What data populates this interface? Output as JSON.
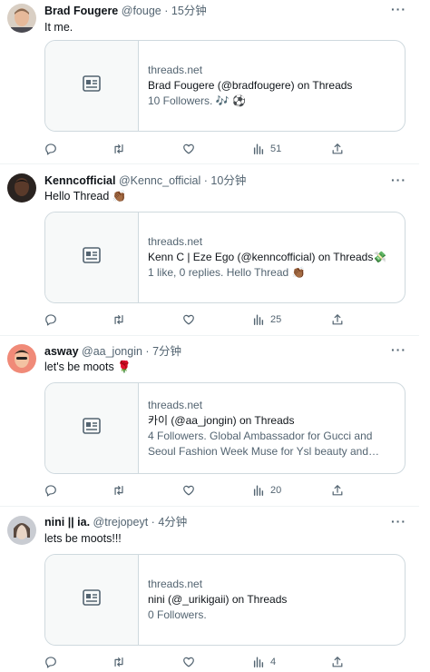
{
  "icons": {
    "reply": "reply-icon",
    "retweet": "retweet-icon",
    "like": "heart-icon",
    "views": "views-icon",
    "share": "share-icon",
    "more": "more-icon",
    "card": "article-icon"
  },
  "tweets": [
    {
      "name": "Brad Fougere",
      "handle": "@fouge",
      "dot": "·",
      "time": "15分钟",
      "text": "It me.",
      "more": "···",
      "card": {
        "domain": "threads.net",
        "title": "Brad Fougere (@bradfougere) on Threads",
        "desc": "10 Followers. 🎶 ⚽"
      },
      "views": "51"
    },
    {
      "name": "Kenncofficial",
      "handle": "@Kennc_official",
      "dot": "·",
      "time": "10分钟",
      "text": "Hello Thread 👏🏾",
      "more": "···",
      "card": {
        "domain": "threads.net",
        "title": "Kenn C | Eze Ego (@kenncofficial) on Threads💸",
        "desc": "1 like, 0 replies. Hello Thread 👏🏾"
      },
      "views": "25"
    },
    {
      "name": "asway",
      "handle": "@aa_jongin",
      "dot": "·",
      "time": "7分钟",
      "text": "let's be moots 🌹",
      "more": "···",
      "card": {
        "domain": "threads.net",
        "title": "카이 (@aa_jongin) on Threads",
        "desc": "4 Followers. Global Ambassador for Gucci and Seoul Fashion Week Muse for Ysl beauty and Hote..."
      },
      "views": "20"
    },
    {
      "name": "nini || ia.",
      "handle": "@trejopeyt",
      "dot": "·",
      "time": "4分钟",
      "text": "lets be moots!!!",
      "more": "···",
      "card": {
        "domain": "threads.net",
        "title": "nini (@_urikigaii) on Threads",
        "desc": "0 Followers."
      },
      "views": "4"
    }
  ]
}
